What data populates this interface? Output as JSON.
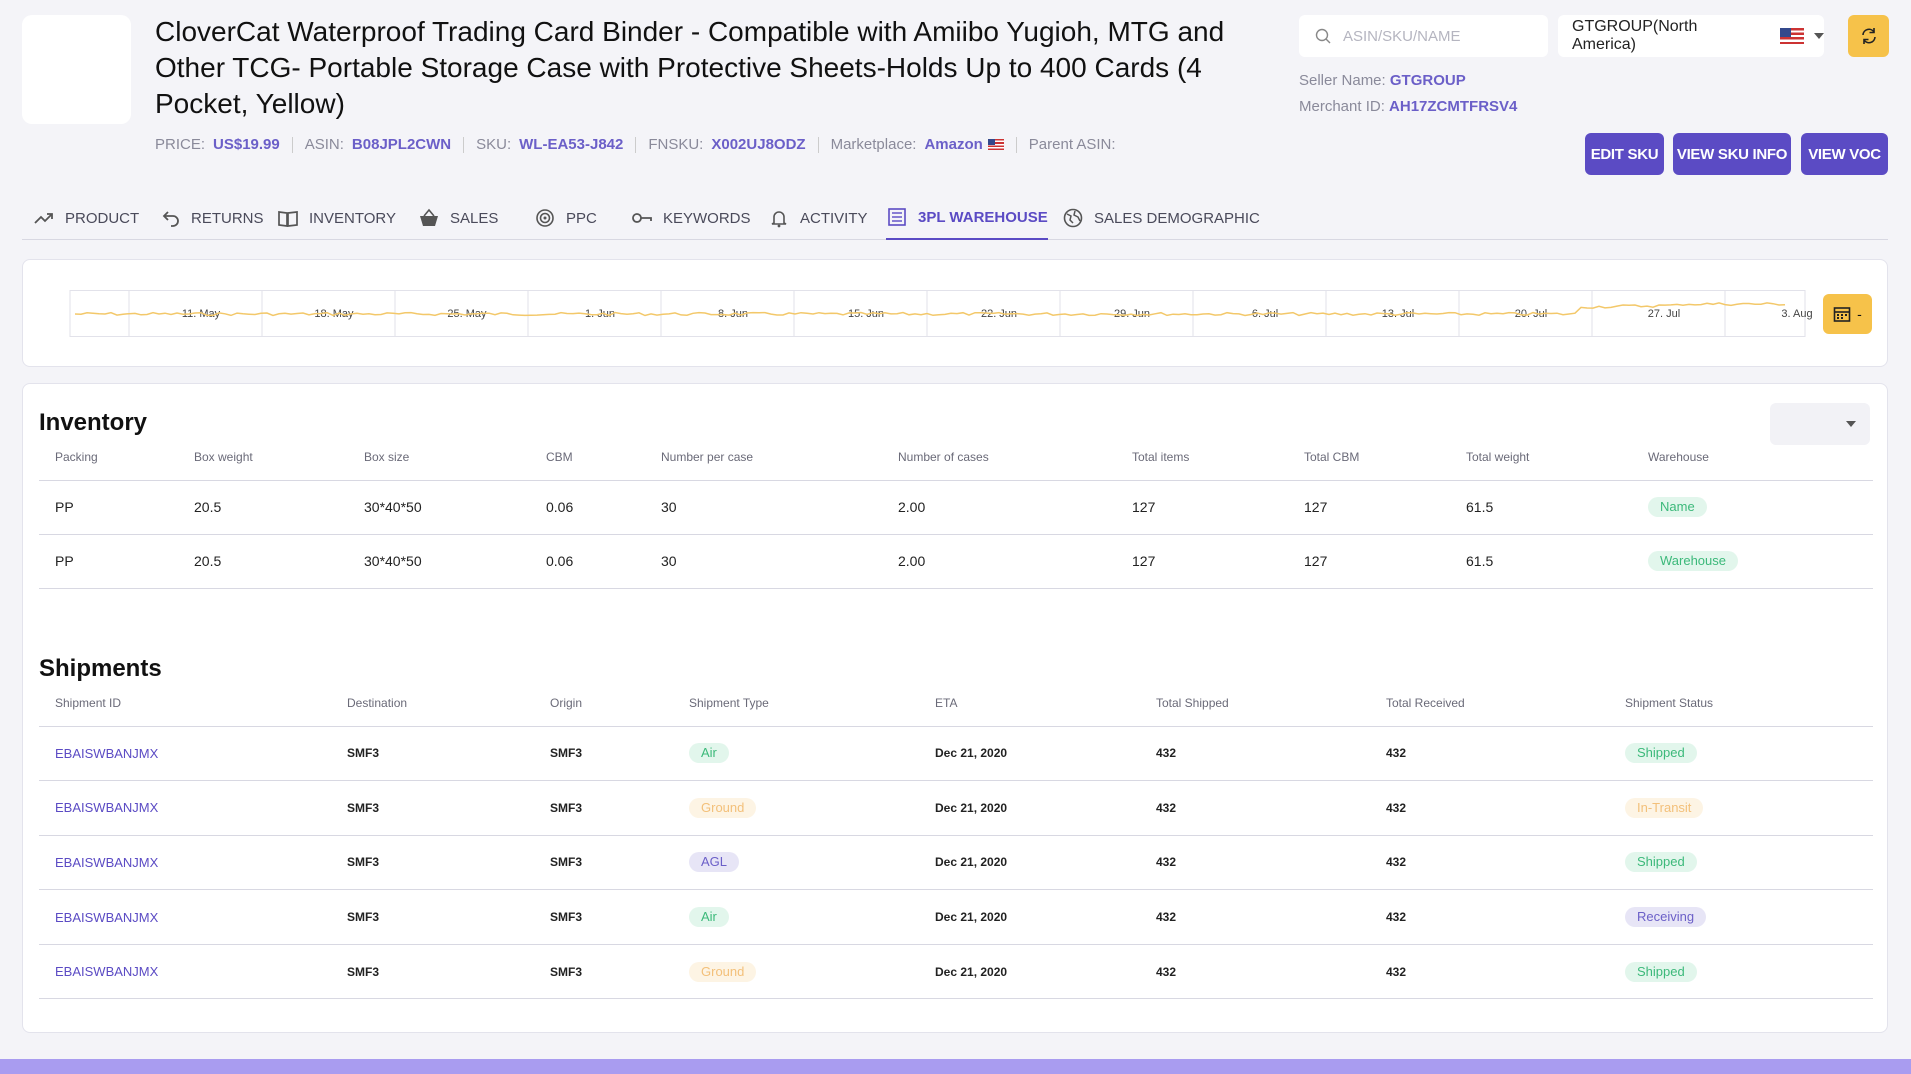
{
  "product": {
    "title": "CloverCat Waterproof Trading Card Binder - Compatible with Amiibo Yugioh, MTG and Other TCG- Portable Storage Case with Protective Sheets-Holds Up to 400 Cards (4 Pocket, Yellow)",
    "meta": [
      {
        "label": "PRICE:",
        "value": "US$19.99"
      },
      {
        "label": "ASIN:",
        "value": "B08JPL2CWN"
      },
      {
        "label": "SKU:",
        "value": "WL-EA53-J842"
      },
      {
        "label": "FNSKU:",
        "value": "X002UJ8ODZ"
      },
      {
        "label": "Marketplace:",
        "value": "Amazon"
      },
      {
        "label": "Parent ASIN:",
        "value": ""
      }
    ]
  },
  "search": {
    "placeholder": "ASIN/SKU/NAME"
  },
  "market_select": {
    "value": "GTGROUP(North America)"
  },
  "seller": {
    "name_label": "Seller Name:",
    "name": "GTGROUP",
    "merchant_label": "Merchant ID:",
    "merchant": "AH17ZCMTFRSV4"
  },
  "buttons": {
    "edit_sku": "EDIT SKU",
    "view_sku_info": "VIEW SKU INFO",
    "view_voc": "VIEW VOC"
  },
  "tabs": [
    {
      "label": "PRODUCT",
      "icon": "trend-icon"
    },
    {
      "label": "RETURNS",
      "icon": "return-icon"
    },
    {
      "label": "INVENTORY",
      "icon": "book-icon"
    },
    {
      "label": "SALES",
      "icon": "basket-icon"
    },
    {
      "label": "PPC",
      "icon": "target-icon"
    },
    {
      "label": "KEYWORDS",
      "icon": "key-icon"
    },
    {
      "label": "ACTIVITY",
      "icon": "bell-icon"
    },
    {
      "label": "3PL WAREHOUSE",
      "icon": "list-icon",
      "active": true
    },
    {
      "label": "SALES DEMOGRAPHIC",
      "icon": "globe-icon"
    }
  ],
  "timeline": {
    "labels": [
      "11. May",
      "18. May",
      "25. May",
      "1. Jun",
      "8. Jun",
      "15. Jun",
      "22. Jun",
      "29. Jun",
      "6. Jul",
      "13. Jul",
      "20. Jul",
      "27. Jul",
      "3. Aug"
    ],
    "date_button": "-",
    "line_color": "#f3c86a"
  },
  "inventory": {
    "title": "Inventory",
    "columns": [
      "Packing",
      "Box weight",
      "Box size",
      "CBM",
      "Number per case",
      "Number of cases",
      "Total items",
      "Total CBM",
      "Total weight",
      "Warehouse"
    ],
    "rows": [
      [
        "PP",
        "20.5",
        "30*40*50",
        "0.06",
        "30",
        "2.00",
        "127",
        "127",
        "61.5",
        "Name"
      ],
      [
        "PP",
        "20.5",
        "30*40*50",
        "0.06",
        "30",
        "2.00",
        "127",
        "127",
        "61.5",
        "Warehouse"
      ]
    ]
  },
  "shipments": {
    "title": "Shipments",
    "columns": [
      "Shipment ID",
      "Destination",
      "Origin",
      "Shipment Type",
      "ETA",
      "Total Shipped",
      "Total Received",
      "Shipment Status"
    ],
    "rows": [
      {
        "id": "EBAISWBANJMX",
        "dest": "SMF3",
        "origin": "SMF3",
        "type": "Air",
        "type_color": "green",
        "eta": "Dec 21, 2020",
        "shipped": "432",
        "received": "432",
        "status": "Shipped",
        "status_color": "green"
      },
      {
        "id": "EBAISWBANJMX",
        "dest": "SMF3",
        "origin": "SMF3",
        "type": "Ground",
        "type_color": "orange",
        "eta": "Dec 21, 2020",
        "shipped": "432",
        "received": "432",
        "status": "In-Transit",
        "status_color": "orange"
      },
      {
        "id": "EBAISWBANJMX",
        "dest": "SMF3",
        "origin": "SMF3",
        "type": "AGL",
        "type_color": "purple",
        "eta": "Dec 21, 2020",
        "shipped": "432",
        "received": "432",
        "status": "Shipped",
        "status_color": "green"
      },
      {
        "id": "EBAISWBANJMX",
        "dest": "SMF3",
        "origin": "SMF3",
        "type": "Air",
        "type_color": "green",
        "eta": "Dec 21, 2020",
        "shipped": "432",
        "received": "432",
        "status": "Receiving",
        "status_color": "purple"
      },
      {
        "id": "EBAISWBANJMX",
        "dest": "SMF3",
        "origin": "SMF3",
        "type": "Ground",
        "type_color": "orange",
        "eta": "Dec 21, 2020",
        "shipped": "432",
        "received": "432",
        "status": "Shipped",
        "status_color": "green"
      }
    ]
  },
  "colors": {
    "accent": "#5b4bc4",
    "warning": "#f6c24a",
    "success": "#3cb97a"
  }
}
